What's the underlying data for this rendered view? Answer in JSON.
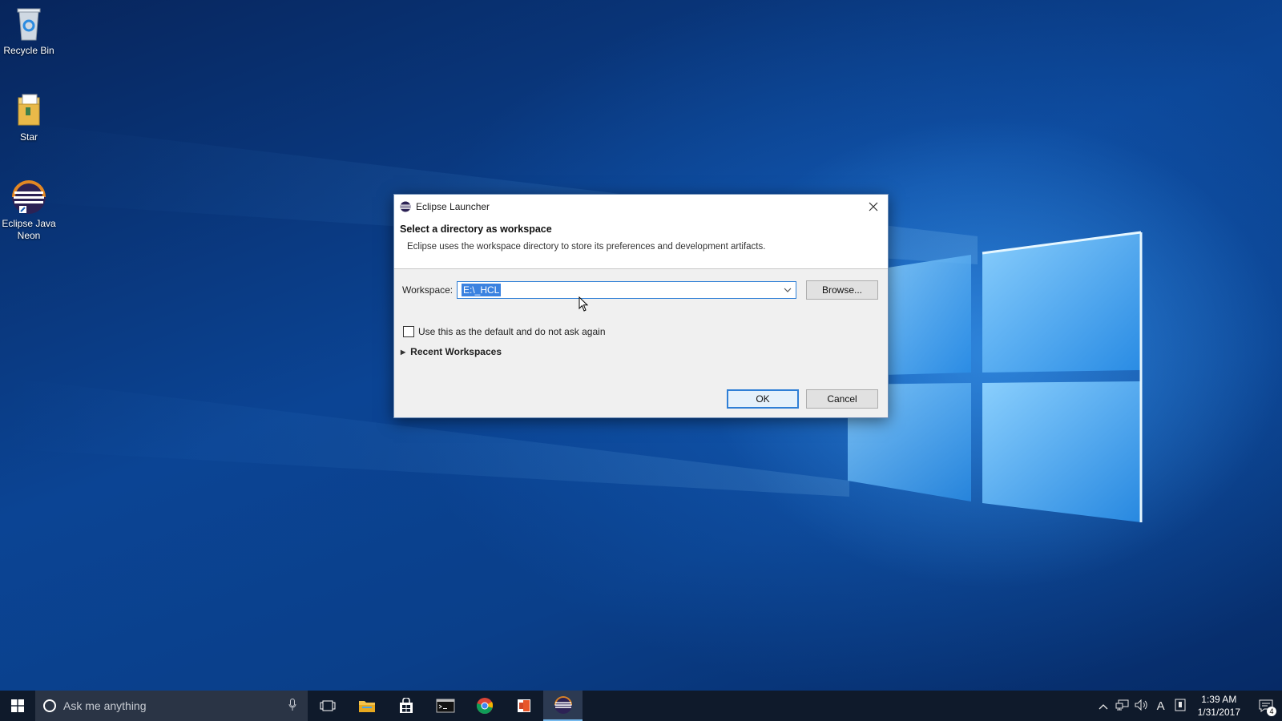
{
  "desktop": {
    "icons": [
      {
        "label": "Recycle Bin",
        "icon": "recycle-bin-icon"
      },
      {
        "label": "Star",
        "icon": "folder-icon"
      },
      {
        "label": "Eclipse Java Neon",
        "icon": "eclipse-icon"
      }
    ]
  },
  "dialog": {
    "title": "Eclipse Launcher",
    "heading": "Select a directory as workspace",
    "description": "Eclipse uses the workspace directory to store its preferences and development artifacts.",
    "workspace_label": "Workspace:",
    "workspace_value": "E:\\_HCL",
    "browse_label": "Browse...",
    "checkbox_label": "Use this as the default and do not ask again",
    "checkbox_checked": false,
    "recent_label": "Recent Workspaces",
    "ok_label": "OK",
    "cancel_label": "Cancel"
  },
  "taskbar": {
    "search_placeholder": "Ask me anything",
    "apps": [
      "task-view-icon",
      "file-explorer-icon",
      "store-icon",
      "terminal-icon",
      "chrome-icon",
      "office-icon",
      "eclipse-icon"
    ],
    "active_app": "eclipse-icon",
    "clock_time": "1:39 AM",
    "clock_date": "1/31/2017",
    "input_indicator": "A",
    "notification_count": "4"
  },
  "colors": {
    "accent": "#2f7fd6",
    "taskbar": "#0f1a2b",
    "selection": "#3b82e0"
  }
}
